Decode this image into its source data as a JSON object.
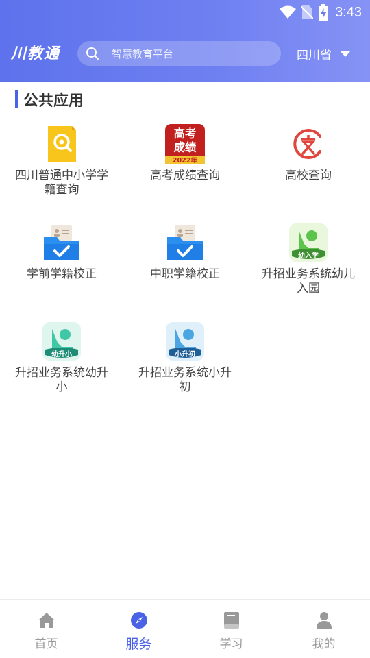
{
  "status_bar": {
    "time": "3:43",
    "icons": [
      "wifi-icon",
      "no-sim-icon",
      "battery-charging-icon"
    ]
  },
  "header": {
    "logo_text": "川教通",
    "search_placeholder": "智慧教育平台",
    "region": "四川省"
  },
  "section": {
    "title": "公共应用"
  },
  "apps": [
    {
      "label": "四川普通中小学学籍查询",
      "icon": "magnifier-document-icon"
    },
    {
      "label": "高考成绩查询",
      "icon": "gaokao-score-icon",
      "icon_text": [
        "高考",
        "成绩",
        "2022年"
      ]
    },
    {
      "label": "高校查询",
      "icon": "university-icon"
    },
    {
      "label": "学前学籍校正",
      "icon": "folder-check-icon"
    },
    {
      "label": "中职学籍校正",
      "icon": "folder-check-icon"
    },
    {
      "label": "升招业务系统幼儿入园",
      "icon": "kindergarten-enrollment-icon",
      "icon_text": "幼入学"
    },
    {
      "label": "升招业务系统幼升小",
      "icon": "kindergarten-to-primary-icon",
      "icon_text": "幼升小"
    },
    {
      "label": "升招业务系统小升初",
      "icon": "primary-to-junior-icon",
      "icon_text": "小升初"
    }
  ],
  "bottom_nav": [
    {
      "label": "首页",
      "icon": "home-icon",
      "active": false
    },
    {
      "label": "服务",
      "icon": "compass-icon",
      "active": true
    },
    {
      "label": "学习",
      "icon": "book-icon",
      "active": false
    },
    {
      "label": "我的",
      "icon": "user-icon",
      "active": false
    }
  ],
  "colors": {
    "header_start": "#5d72ec",
    "header_end": "#8693f5",
    "accent": "#4a63e6"
  }
}
